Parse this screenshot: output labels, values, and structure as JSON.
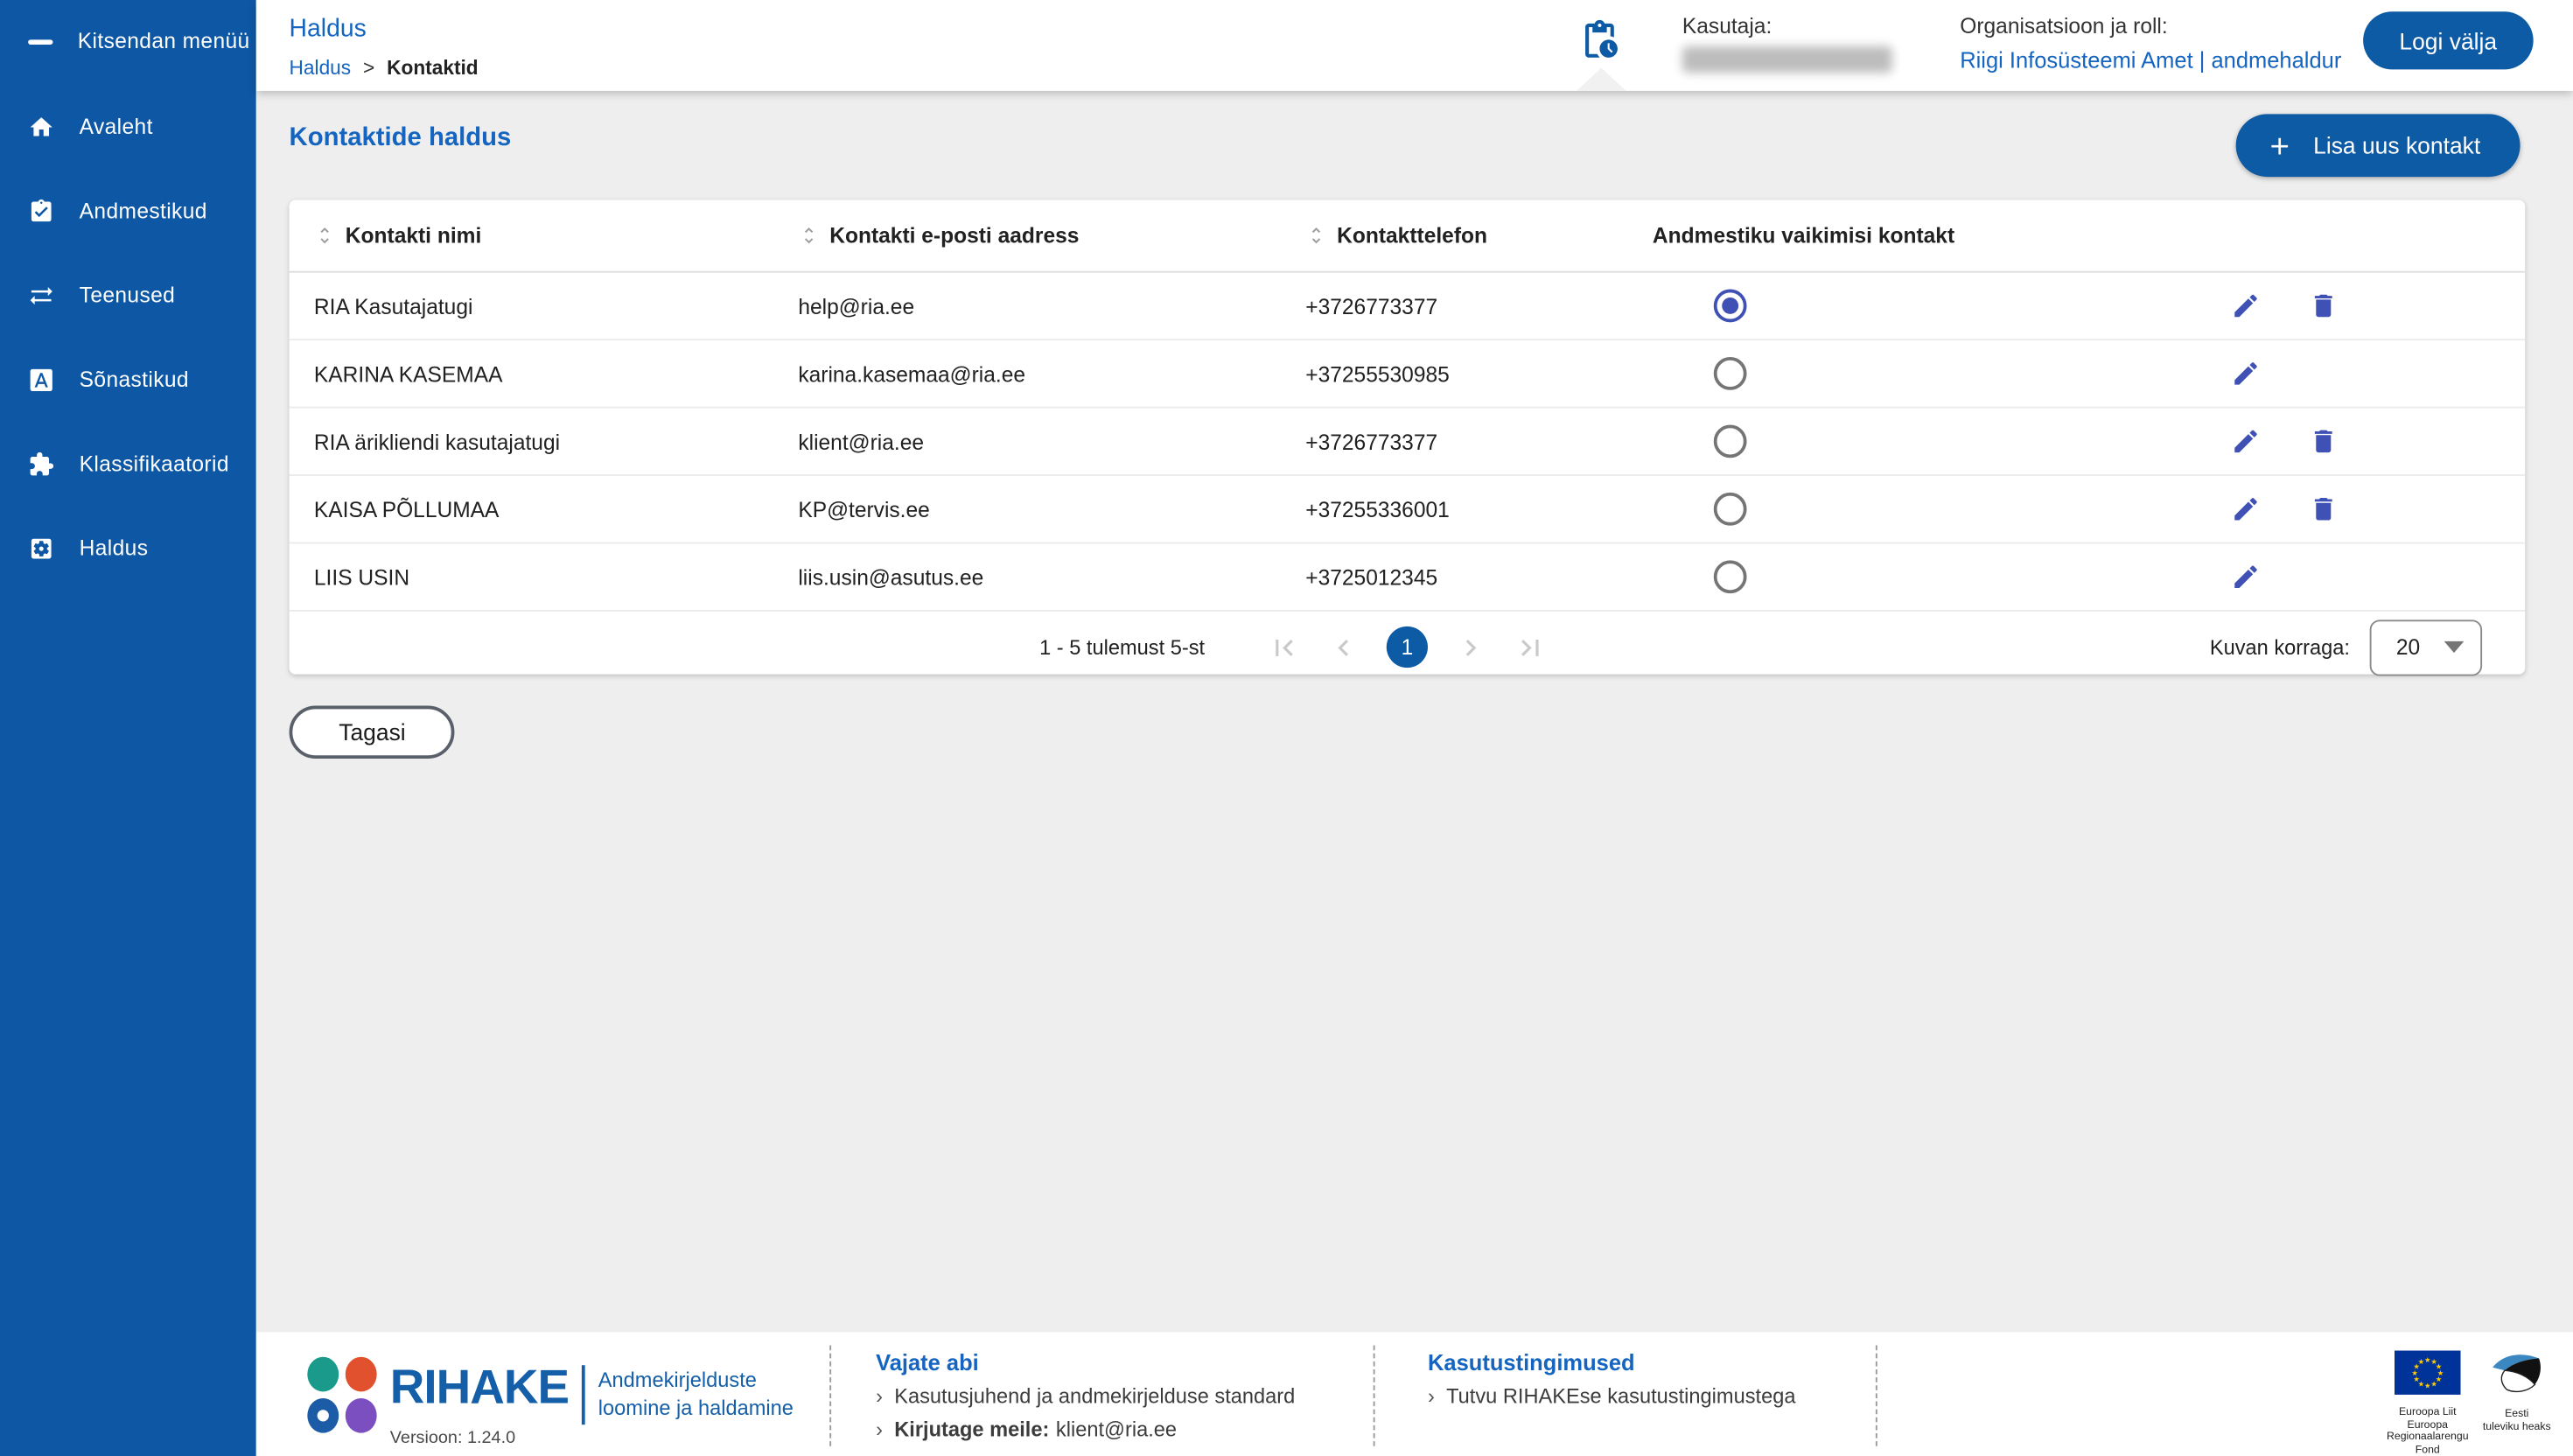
{
  "sidebar": {
    "collapse_label": "Kitsendan menüü",
    "items": [
      {
        "label": "Avaleht",
        "icon": "home-icon"
      },
      {
        "label": "Andmestikud",
        "icon": "clipboard-check-icon"
      },
      {
        "label": "Teenused",
        "icon": "swap-arrows-icon"
      },
      {
        "label": "Sõnastikud",
        "icon": "letter-a-box-icon"
      },
      {
        "label": "Klassifikaatorid",
        "icon": "puzzle-icon"
      },
      {
        "label": "Haldus",
        "icon": "gear-box-icon"
      }
    ]
  },
  "header": {
    "title": "Haldus",
    "breadcrumb": {
      "link": "Haldus",
      "separator": ">",
      "current": "Kontaktid"
    },
    "notification_icon": "clipboard-clock-icon",
    "user_label": "Kasutaja:",
    "user_value_redacted": true,
    "org_label": "Organisatsioon ja roll:",
    "org_value": "Riigi Infosüsteemi Amet | andmehaldur",
    "logout_label": "Logi välja"
  },
  "content": {
    "page_title": "Kontaktide haldus",
    "add_button_label": "Lisa uus kontakt",
    "back_button_label": "Tagasi",
    "table": {
      "columns": [
        "Kontakti nimi",
        "Kontakti e-posti aadress",
        "Kontakttelefon",
        "Andmestiku vaikimisi kontakt"
      ],
      "rows": [
        {
          "name": "RIA Kasutajatugi",
          "email": "help@ria.ee",
          "phone": "+3726773377",
          "default_contact": true,
          "can_delete": true
        },
        {
          "name": "KARINA KASEMAA",
          "email": "karina.kasemaa@ria.ee",
          "phone": "+37255530985",
          "default_contact": false,
          "can_delete": false
        },
        {
          "name": "RIA ärikliendi kasutajatugi",
          "email": "klient@ria.ee",
          "phone": "+3726773377",
          "default_contact": false,
          "can_delete": true
        },
        {
          "name": "KAISA PÕLLUMAA",
          "email": "KP@tervis.ee",
          "phone": "+37255336001",
          "default_contact": false,
          "can_delete": true
        },
        {
          "name": "LIIS USIN",
          "email": "liis.usin@asutus.ee",
          "phone": "+3725012345",
          "default_contact": false,
          "can_delete": false
        }
      ],
      "pagination": {
        "summary": "1 - 5 tulemust 5-st",
        "current_page": "1",
        "per_page_label": "Kuvan korraga:",
        "per_page_value": "20"
      }
    }
  },
  "footer": {
    "brand": {
      "name": "RIHAKE",
      "tagline_line1": "Andmekirjelduste",
      "tagline_line2": "loomine ja haldamine",
      "version": "Versioon: 1.24.0"
    },
    "help": {
      "title": "Vajate abi",
      "bullet": "›",
      "link1": {
        "prefix": "",
        "text": "Kasutusjuhend ja andmekirjelduse standard"
      },
      "link2": {
        "prefix": "Kirjutage meile:",
        "text": "klient@ria.ee"
      }
    },
    "terms": {
      "title": "Kasutustingimused",
      "bullet": "›",
      "link1": {
        "prefix": "",
        "text": "Tutvu RIHAKEse kasutustingimustega"
      }
    },
    "eu_logo_caption": {
      "line1": "Euroopa Liit",
      "line2": "Euroopa",
      "line3": "Regionaalarengu Fond"
    },
    "ee_logo_caption": {
      "line1": "Eesti",
      "line2": "tuleviku heaks"
    }
  },
  "colors": {
    "sidebar_bg": "#0d57a4",
    "primary_button_blue": "#0d5aa5",
    "link_blue": "#1565c0",
    "action_indigo": "#3f51b5",
    "content_bg": "#eeeeee",
    "footer_brand_blue": "#155fa9"
  }
}
